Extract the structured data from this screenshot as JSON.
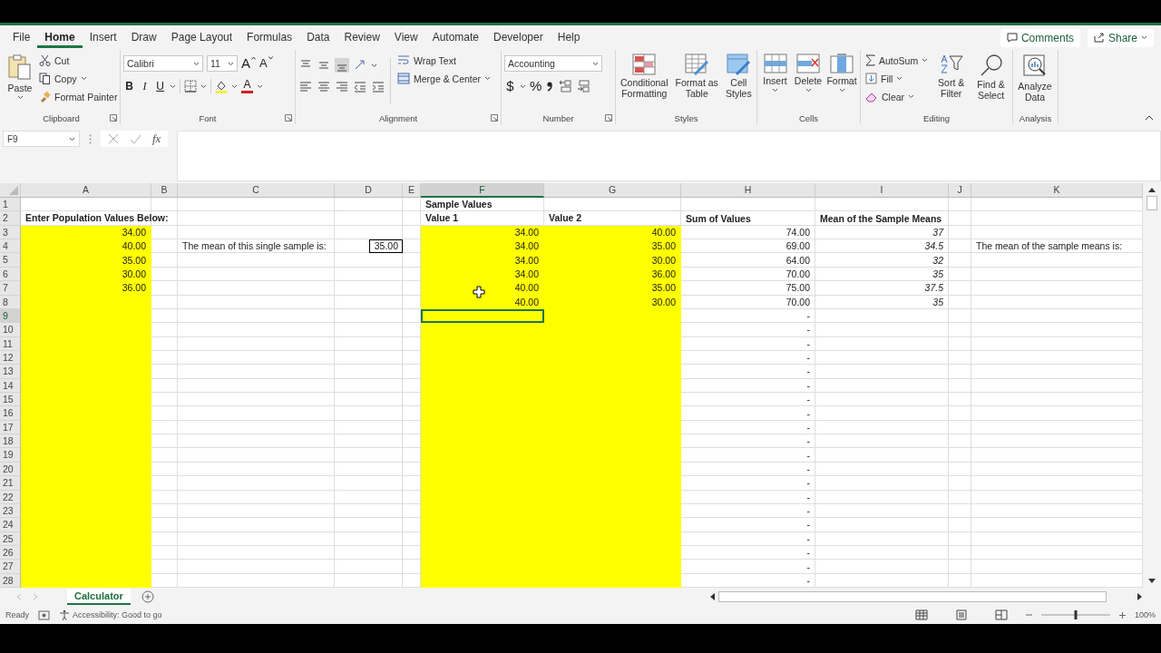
{
  "ribbon_tabs": [
    {
      "label": "File",
      "selected": false
    },
    {
      "label": "Home",
      "selected": true
    },
    {
      "label": "Insert",
      "selected": false
    },
    {
      "label": "Draw",
      "selected": false
    },
    {
      "label": "Page Layout",
      "selected": false
    },
    {
      "label": "Formulas",
      "selected": false
    },
    {
      "label": "Data",
      "selected": false
    },
    {
      "label": "Review",
      "selected": false
    },
    {
      "label": "View",
      "selected": false
    },
    {
      "label": "Automate",
      "selected": false
    },
    {
      "label": "Developer",
      "selected": false
    },
    {
      "label": "Help",
      "selected": false
    }
  ],
  "top_buttons": {
    "comments": "Comments",
    "share": "Share"
  },
  "ribbon": {
    "clipboard": {
      "label": "Clipboard",
      "paste": "Paste",
      "cut": "Cut",
      "copy": "Copy",
      "format_painter": "Format Painter"
    },
    "font": {
      "label": "Font",
      "font_name": "Calibri",
      "font_size": "11",
      "grow": "A",
      "shrink": "A",
      "bold": "B",
      "italic": "I",
      "underline": "U",
      "font_color": "A"
    },
    "alignment": {
      "label": "Alignment",
      "wrap_text": "Wrap Text",
      "merge_center": "Merge & Center"
    },
    "number": {
      "label": "Number",
      "format": "Accounting",
      "currency": "$",
      "percent": "%"
    },
    "styles": {
      "label": "Styles",
      "conditional_formatting": "Conditional Formatting",
      "format_as_table": "Format as Table",
      "cell_styles": "Cell Styles"
    },
    "cells": {
      "label": "Cells",
      "insert": "Insert",
      "delete": "Delete",
      "format": "Format"
    },
    "editing": {
      "label": "Editing",
      "autosum": "AutoSum",
      "fill": "Fill",
      "clear": "Clear",
      "sort_filter": "Sort & Filter",
      "find_select": "Find & Select"
    },
    "analysis": {
      "label": "Analysis",
      "analyze_data": "Analyze Data"
    }
  },
  "formula_bar": {
    "name_box": "F9",
    "function_label": "fx"
  },
  "columns": [
    {
      "letter": "A",
      "selected": false,
      "highlighted": true
    },
    {
      "letter": "B",
      "selected": false
    },
    {
      "letter": "C",
      "selected": false
    },
    {
      "letter": "D",
      "selected": false
    },
    {
      "letter": "E",
      "selected": false
    },
    {
      "letter": "F",
      "selected": true,
      "highlighted": true
    },
    {
      "letter": "G",
      "selected": false,
      "highlighted": true
    },
    {
      "letter": "H",
      "selected": false
    },
    {
      "letter": "I",
      "selected": false,
      "italic": true
    },
    {
      "letter": "J",
      "selected": false
    },
    {
      "letter": "K",
      "selected": false
    }
  ],
  "rows": [
    {
      "number": "1",
      "kind": "header",
      "selected": false,
      "cells": {
        "F": "Sample Values"
      }
    },
    {
      "number": "2",
      "kind": "header",
      "selected": false,
      "cells": {
        "A": "Enter Population Values Below:",
        "F": "Value 1",
        "G": "Value 2",
        "H": "Sum of Values",
        "I": "Mean of the Sample Means"
      }
    },
    {
      "number": "3",
      "kind": "data",
      "selected": false,
      "cells": {
        "A": "34.00",
        "F": "34.00",
        "G": "40.00",
        "H": "74.00",
        "I": "37"
      }
    },
    {
      "number": "4",
      "kind": "data",
      "selected": false,
      "boxed": {
        "D": true
      },
      "labels": {
        "C": "The mean of this single sample is:",
        "K": "The mean of the sample means is:"
      },
      "cells": {
        "A": "40.00",
        "D": "35.00",
        "F": "34.00",
        "G": "35.00",
        "H": "69.00",
        "I": "34.5"
      }
    },
    {
      "number": "5",
      "kind": "data",
      "selected": false,
      "cells": {
        "A": "35.00",
        "F": "34.00",
        "G": "30.00",
        "H": "64.00",
        "I": "32"
      }
    },
    {
      "number": "6",
      "kind": "data",
      "selected": false,
      "cells": {
        "A": "30.00",
        "F": "34.00",
        "G": "36.00",
        "H": "70.00",
        "I": "35"
      }
    },
    {
      "number": "7",
      "kind": "data",
      "selected": false,
      "cells": {
        "A": "36.00",
        "F": "40.00",
        "G": "35.00",
        "H": "75.00",
        "I": "37.5"
      }
    },
    {
      "number": "8",
      "kind": "data",
      "selected": false,
      "cells": {
        "F": "40.00",
        "G": "30.00",
        "H": "70.00",
        "I": "35"
      }
    },
    {
      "number": "9",
      "kind": "data",
      "selected": true,
      "cells": {
        "H": "-"
      }
    },
    {
      "number": "10",
      "kind": "data",
      "selected": false,
      "cells": {
        "H": "-"
      }
    },
    {
      "number": "11",
      "kind": "data",
      "selected": false,
      "cells": {
        "H": "-"
      }
    },
    {
      "number": "12",
      "kind": "data",
      "selected": false,
      "cells": {
        "H": "-"
      }
    },
    {
      "number": "13",
      "kind": "data",
      "selected": false,
      "cells": {
        "H": "-"
      }
    },
    {
      "number": "14",
      "kind": "data",
      "selected": false,
      "cells": {
        "H": "-"
      }
    },
    {
      "number": "15",
      "kind": "data",
      "selected": false,
      "cells": {
        "H": "-"
      }
    },
    {
      "number": "16",
      "kind": "data",
      "selected": false,
      "cells": {
        "H": "-"
      }
    },
    {
      "number": "17",
      "kind": "data",
      "selected": false,
      "cells": {
        "H": "-"
      }
    },
    {
      "number": "18",
      "kind": "data",
      "selected": false,
      "cells": {
        "H": "-"
      }
    },
    {
      "number": "19",
      "kind": "data",
      "selected": false,
      "cells": {
        "H": "-"
      }
    },
    {
      "number": "20",
      "kind": "data",
      "selected": false,
      "cells": {
        "H": "-"
      }
    },
    {
      "number": "21",
      "kind": "data",
      "selected": false,
      "cells": {
        "H": "-"
      }
    },
    {
      "number": "22",
      "kind": "data",
      "selected": false,
      "cells": {
        "H": "-"
      }
    },
    {
      "number": "23",
      "kind": "data",
      "selected": false,
      "cells": {
        "H": "-"
      }
    },
    {
      "number": "24",
      "kind": "data",
      "selected": false,
      "cells": {
        "H": "-"
      }
    },
    {
      "number": "25",
      "kind": "data",
      "selected": false,
      "cells": {
        "H": "-"
      }
    },
    {
      "number": "26",
      "kind": "data",
      "selected": false,
      "cells": {
        "H": "-"
      }
    },
    {
      "number": "27",
      "kind": "data",
      "selected": false,
      "cells": {
        "H": "-"
      }
    },
    {
      "number": "28",
      "kind": "data",
      "selected": false,
      "cells": {
        "H": "-"
      }
    }
  ],
  "sheet_tabs": [
    {
      "label": "Calculator",
      "selected": true
    }
  ],
  "status_bar": {
    "mode": "Ready",
    "accessibility": "Accessibility: Good to go",
    "zoom_slider": {
      "level": 0.5
    },
    "zoom": "100%"
  }
}
